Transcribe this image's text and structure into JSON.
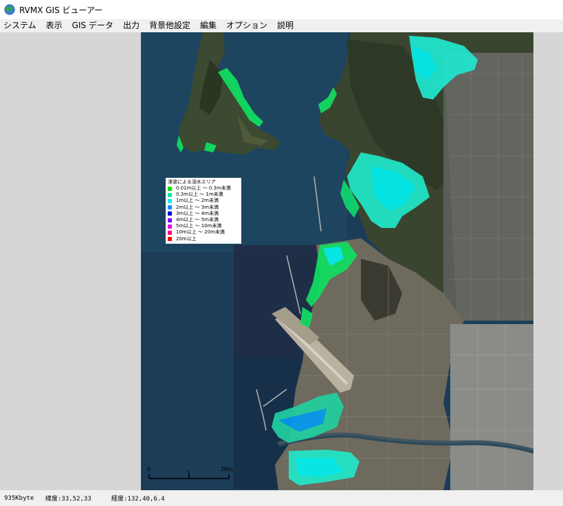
{
  "window": {
    "title": "RVMX GIS ビューアー",
    "icon": "globe-icon"
  },
  "menu": {
    "items": [
      {
        "label": "システム"
      },
      {
        "label": "表示"
      },
      {
        "label": "GIS データ"
      },
      {
        "label": "出力"
      },
      {
        "label": "背景他設定"
      },
      {
        "label": "編集"
      },
      {
        "label": "オプション"
      },
      {
        "label": "説明"
      }
    ]
  },
  "map": {
    "layer": "satellite-imagery",
    "legend": {
      "title": "津波による浸水エリア",
      "items": [
        {
          "label": "0.01m以上 ～ 0.3m未満",
          "color": "#00e000"
        },
        {
          "label": "0.3m以上 ～ 1m未満",
          "color": "#00e8a0"
        },
        {
          "label": "1m以上 ～ 2m未満",
          "color": "#00f0f0"
        },
        {
          "label": "2m以上 ～ 3m未満",
          "color": "#0090ff"
        },
        {
          "label": "3m以上 ～ 4m未満",
          "color": "#0000e0"
        },
        {
          "label": "4m以上 ～ 5m未満",
          "color": "#8000ff"
        },
        {
          "label": "5m以上 ～ 10m未満",
          "color": "#e000e0"
        },
        {
          "label": "10m以上 ～ 20m未満",
          "color": "#ff0080"
        },
        {
          "label": "20m以上",
          "color": "#ff0000"
        }
      ]
    },
    "scale": {
      "ticks": [
        "0",
        "1",
        "2Km"
      ]
    }
  },
  "status": {
    "size": "935Kbyte",
    "latitude": "緯度:33,52,33",
    "longitude": "経度:132,40,6.4"
  }
}
